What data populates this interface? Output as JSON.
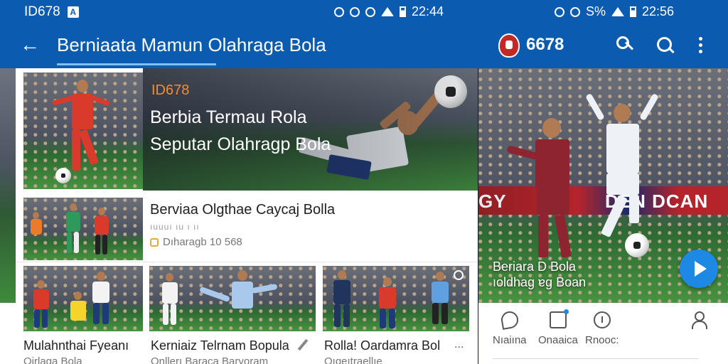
{
  "status_bar": {
    "left_text": "ID678",
    "left_icon": "A",
    "time_primary": "22:44",
    "time_secondary": "22:56",
    "signal_secondary": "S%"
  },
  "app_bar": {
    "title": "Berniaata Mamun  Olahraga Bola",
    "club_label": "6678"
  },
  "hero": {
    "tag": "ID678",
    "title": "Berbia Termau Rola Seputar Olahragp Bola"
  },
  "secondary_article": {
    "title": "Berviaa Olgthae Caycaj Bolla",
    "sub": "ıuuuı ıu ı ıı",
    "meta": "Dıharagb 10 568"
  },
  "grid_articles": [
    {
      "title": "Mulahnthai Fyeanı",
      "sub": "Qirlaga Bola"
    },
    {
      "title": "Kerniaiz Telrnam Bopula",
      "sub": "Onllerı Baraca Baryoram"
    },
    {
      "title": "Rolla! Oardamra Bol",
      "sub": "Oıqeıtraellıe"
    }
  ],
  "grid_ellipsis": "...",
  "side_video": {
    "caption_line1": "Beriara D Bola",
    "caption_line2": "ıoldhag ɐg Boan",
    "banner_left": "GY",
    "banner_right": "DEN  DCAN"
  },
  "bottom_nav": [
    {
      "label": "Nıaiına",
      "icon": "feather-icon"
    },
    {
      "label": "Onaaica",
      "icon": "badge-icon"
    },
    {
      "label": "Rnooc:",
      "icon": "info-icon"
    },
    {
      "label": "",
      "icon": "person-icon"
    }
  ],
  "colors": {
    "app_bar": "#0b5cb0",
    "accent_orange": "#f28c38",
    "play_button": "#1e88e5",
    "tab_underline": "#7fc1ff"
  }
}
